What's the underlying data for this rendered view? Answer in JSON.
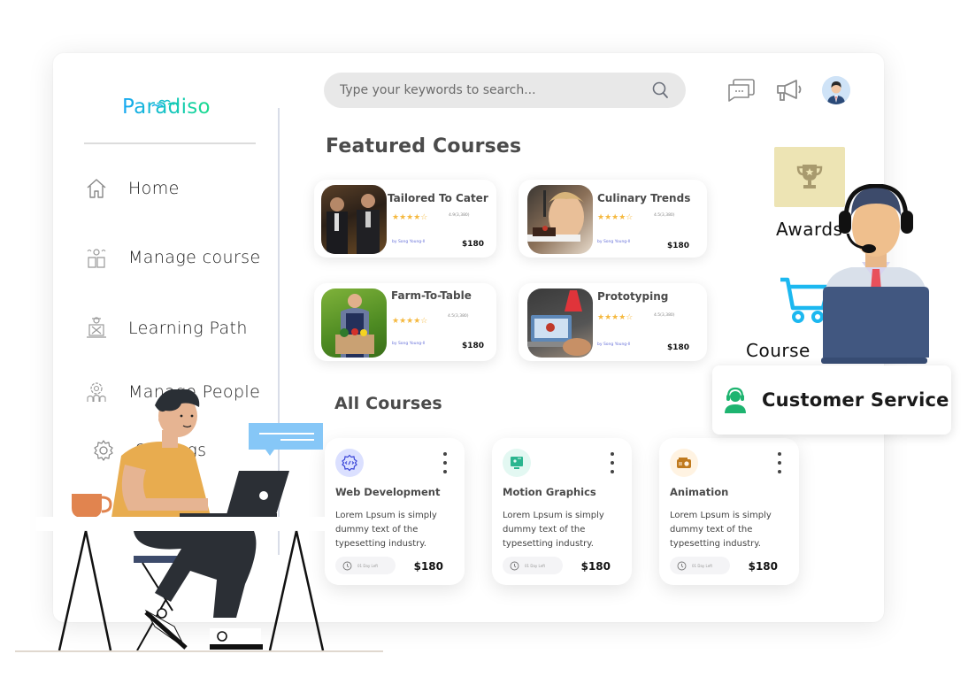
{
  "brand": {
    "name": "Paradiso",
    "gradient": [
      "#17a7f2",
      "#1bdc8c"
    ]
  },
  "sidebar": {
    "items": [
      {
        "label": "Home",
        "icon": "home-icon"
      },
      {
        "label": "Manage course",
        "icon": "book-gear-icon"
      },
      {
        "label": "Learning Path",
        "icon": "learner-icon"
      },
      {
        "label": "Manage People",
        "icon": "people-gear-icon"
      },
      {
        "label": "Settings",
        "icon": "gear-icon"
      }
    ]
  },
  "header": {
    "search_placeholder": "Type your keywords to search...",
    "icons": [
      "chat-icon",
      "megaphone-icon",
      "user-avatar"
    ]
  },
  "featured": {
    "title": "Featured Courses",
    "courses": [
      {
        "title": "Tailored To Cater",
        "stars": 4,
        "rating": "4.9(3,380)",
        "author": "by Song Young-Il",
        "price": "$180"
      },
      {
        "title": "Culinary Trends",
        "stars": 4,
        "rating": "4.5(3,380)",
        "author": "by Song Young-Il",
        "price": "$180"
      },
      {
        "title": "Farm-To-Table",
        "stars": 4,
        "rating": "4.5(3,380)",
        "author": "by Song Young-Il",
        "price": "$180"
      },
      {
        "title": "Prototyping",
        "stars": 4,
        "rating": "4.5(3,380)",
        "author": "by Song Young-Il",
        "price": "$180"
      }
    ]
  },
  "all_courses": {
    "title": "All Courses",
    "courses": [
      {
        "title": "Web Development",
        "description": "Lorem Lpsum is simply dummy text of the typesetting industry.",
        "time_left": "01 Day Left",
        "price": "$180",
        "icon": "code-gear-icon",
        "icon_bg": "#dbe0ff",
        "icon_color": "#3a45d8"
      },
      {
        "title": "Motion Graphics",
        "description": "Lorem Lpsum is simply dummy text of the typesetting industry.",
        "time_left": "01 Day Left",
        "price": "$180",
        "icon": "monitor-icon",
        "icon_bg": "#e3f8f2",
        "icon_color": "#2bb58f"
      },
      {
        "title": "Animation",
        "description": "Lorem Lpsum is simply dummy text of the typesetting industry.",
        "time_left": "01 Day Left",
        "price": "$180",
        "icon": "film-camera-icon",
        "icon_bg": "#fff3e2",
        "icon_color": "#c07a1e"
      }
    ]
  },
  "widgets": {
    "awards_label": "Awards",
    "course_label": "Course",
    "customer_service_label": "Customer Service"
  }
}
